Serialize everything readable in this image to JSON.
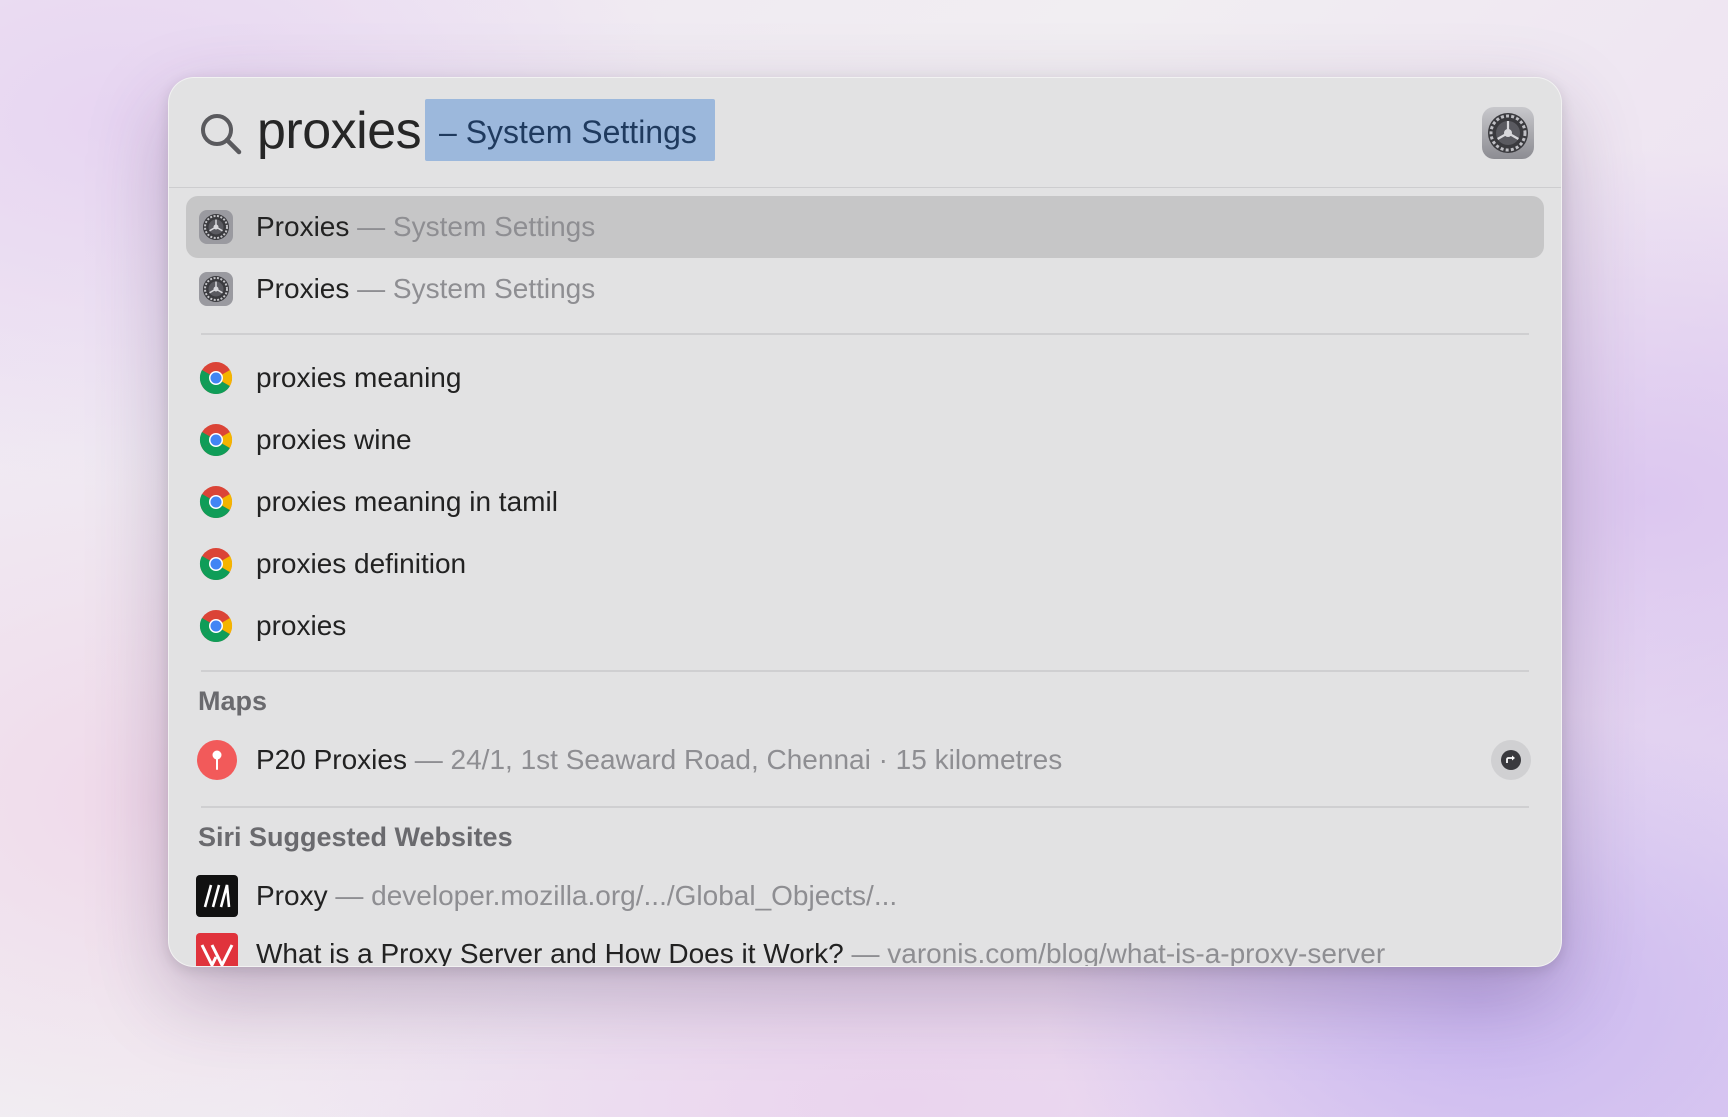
{
  "search": {
    "query": "proxies",
    "completion": "– System Settings",
    "app_icon": "system-settings-gear-icon"
  },
  "top_hits": [
    {
      "title": "Proxies",
      "subtitle": "— System Settings",
      "icon": "system-settings-gear-icon",
      "selected": true
    },
    {
      "title": "Proxies",
      "subtitle": "— System Settings",
      "icon": "system-settings-gear-icon",
      "selected": false
    }
  ],
  "suggestions": [
    {
      "title": "proxies meaning",
      "icon": "chrome-icon"
    },
    {
      "title": "proxies wine",
      "icon": "chrome-icon"
    },
    {
      "title": "proxies meaning in tamil",
      "icon": "chrome-icon"
    },
    {
      "title": "proxies definition",
      "icon": "chrome-icon"
    },
    {
      "title": "proxies",
      "icon": "chrome-icon"
    }
  ],
  "maps": {
    "header": "Maps",
    "items": [
      {
        "title": "P20 Proxies",
        "subtitle": "— 24/1, 1st Seaward Road, Chennai · 15 kilometres",
        "icon": "map-pin-icon"
      }
    ]
  },
  "siri_websites": {
    "header": "Siri Suggested Websites",
    "items": [
      {
        "title": "Proxy",
        "subtitle": "— developer.mozilla.org/.../Global_Objects/...",
        "icon": "mdn-icon"
      },
      {
        "title": "What is a Proxy Server and How Does it Work?",
        "subtitle": "— varonis.com/blog/what-is-a-proxy-server",
        "icon": "varonis-icon"
      }
    ]
  },
  "colors": {
    "selection_highlight": "#9cb8dc",
    "selected_row": "#c6c6c7",
    "panel_background": "#e2e2e3",
    "map_pin": "#f25a5a"
  }
}
